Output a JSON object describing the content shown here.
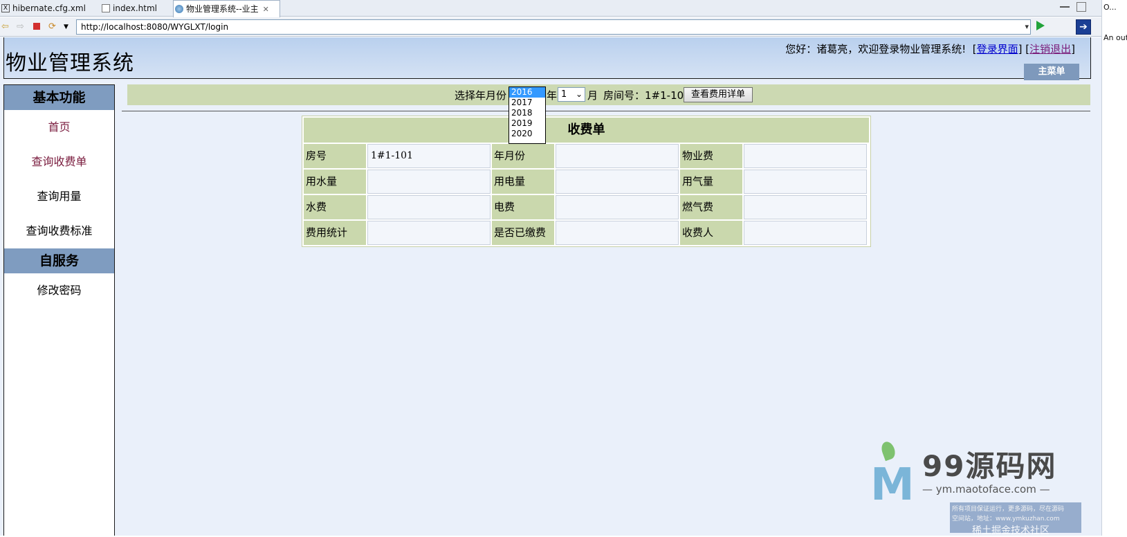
{
  "tabs": [
    {
      "label": "hibernate.cfg.xml",
      "icon": "xml-file-icon"
    },
    {
      "label": "index.html",
      "icon": "html-file-icon"
    },
    {
      "label": "物业管理系统--业主",
      "icon": "globe-icon",
      "active": true
    }
  ],
  "url": "http://localhost:8080/WYGLXT/login",
  "right_panel": {
    "outline_label": "O...",
    "text": "An out"
  },
  "header": {
    "logo": "物业管理系统",
    "greeting": "您好：诸葛亮，欢迎登录物业管理系统!",
    "login_link": "登录界面",
    "logout_link": "注销退出",
    "main_menu": "主菜单"
  },
  "sidebar": {
    "section1": "基本功能",
    "items1": [
      "首页",
      "查询收费单",
      "查询用量",
      "查询收费标准"
    ],
    "section2": "自服务",
    "items2": [
      "修改密码"
    ]
  },
  "selector": {
    "label": "选择年月份",
    "year_options": [
      "2016",
      "2017",
      "2018",
      "2019",
      "2020"
    ],
    "year_selected": "2016",
    "year_suffix": "年",
    "month_value": "1",
    "month_suffix": "月",
    "room_label": "房间号：",
    "room_value": "1#1-101",
    "button": "查看费用详单"
  },
  "bill": {
    "title": "收费单",
    "rows": [
      [
        {
          "label": "房号",
          "value": "1#1-101"
        },
        {
          "label": "年月份",
          "value": ""
        },
        {
          "label": "物业费",
          "value": ""
        }
      ],
      [
        {
          "label": "用水量",
          "value": ""
        },
        {
          "label": "用电量",
          "value": ""
        },
        {
          "label": "用气量",
          "value": ""
        }
      ],
      [
        {
          "label": "水费",
          "value": ""
        },
        {
          "label": "电费",
          "value": ""
        },
        {
          "label": "燃气费",
          "value": ""
        }
      ],
      [
        {
          "label": "费用统计",
          "value": ""
        },
        {
          "label": "是否已缴费",
          "value": ""
        },
        {
          "label": "收费人",
          "value": ""
        }
      ]
    ]
  },
  "watermark": {
    "title": "99源码网",
    "url": "— ym.maotoface.com —",
    "box_line1": "所有项目保证运行，更多源码，尽在源码",
    "box_line2": "空间站，地址：www.ymkuzhan.com",
    "community": "稀土掘金技术社区"
  }
}
